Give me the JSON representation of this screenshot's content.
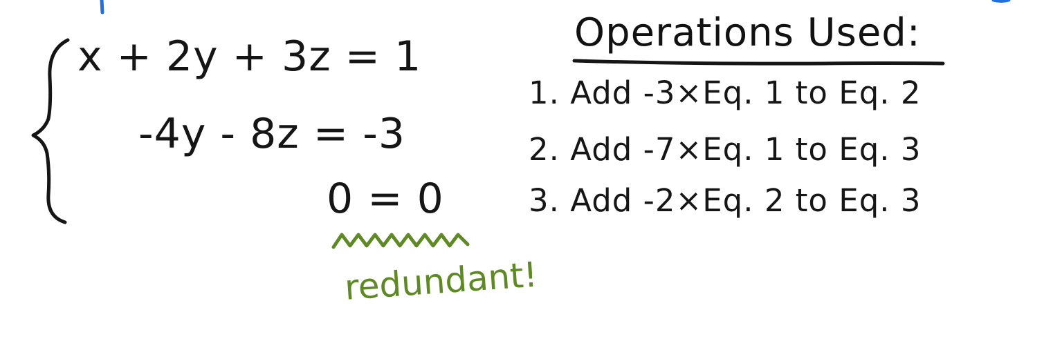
{
  "system": {
    "equations": [
      "x + 2y + 3z = 1",
      "-4y - 8z = -3",
      "0 = 0"
    ]
  },
  "operations": {
    "heading": "Operations Used:",
    "items": [
      "1. Add -3×Eq. 1 to Eq. 2",
      "2. Add -7×Eq. 1 to Eq. 3",
      "3. Add -2×Eq. 2 to Eq. 3"
    ]
  },
  "annotation": {
    "text": "redundant!",
    "color": "#5e8a23"
  },
  "ink": {
    "main": "#151515",
    "blue": "#1f6fe5"
  }
}
